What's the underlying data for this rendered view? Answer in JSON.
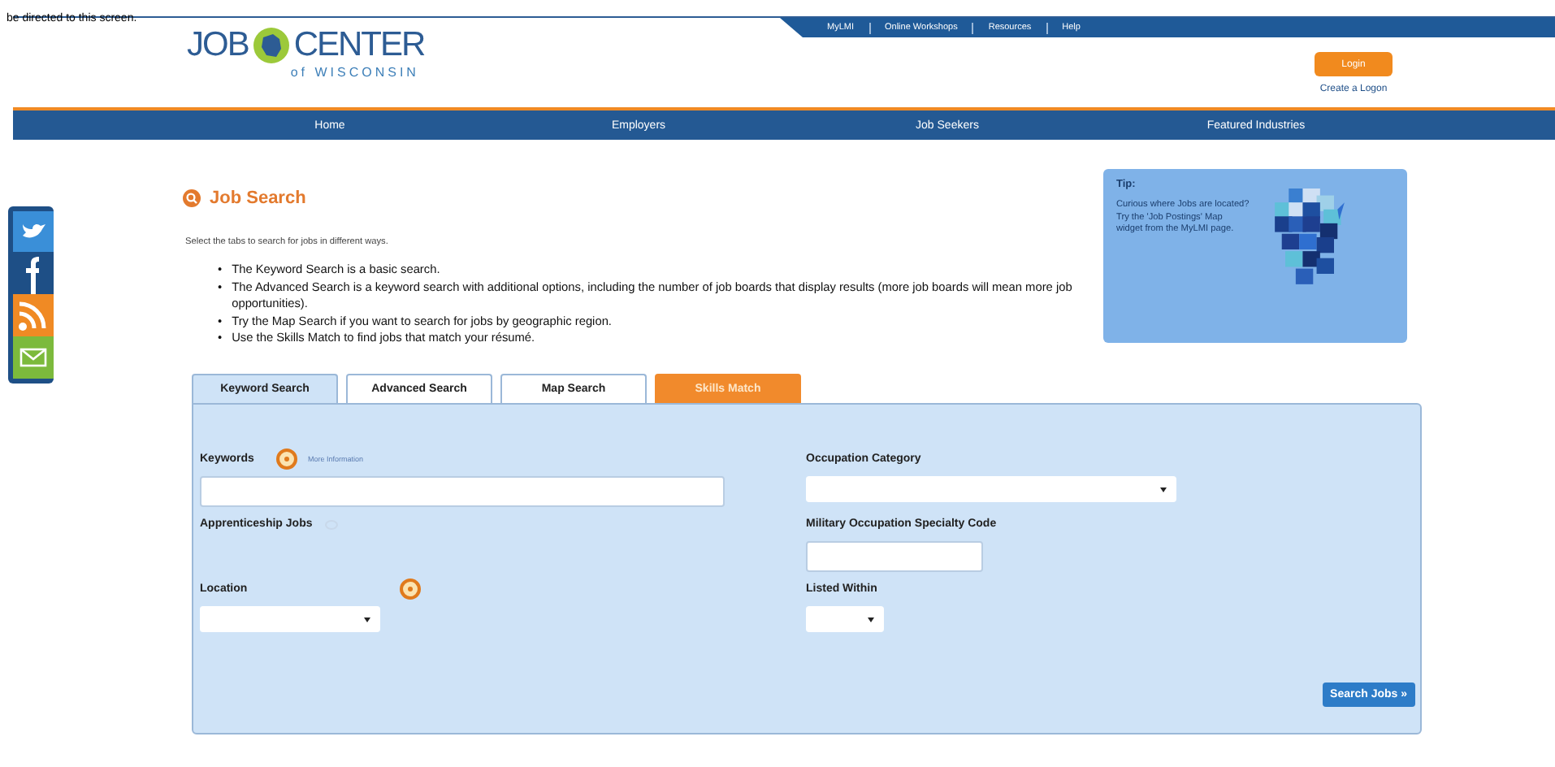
{
  "caption": "be directed to this screen.",
  "utility_links": [
    "MyLMI",
    "Online Workshops",
    "Resources",
    "Help"
  ],
  "logo": {
    "word_1": "JOB",
    "word_2": "CENTER",
    "subtitle": "of WISCONSIN"
  },
  "login": {
    "button": "Login",
    "link": "Create a Logon"
  },
  "nav": [
    "Home",
    "Employers",
    "Job Seekers",
    "Featured Industries"
  ],
  "heading": "Job Search",
  "intro": "Select the tabs to search for jobs in different ways.",
  "bullets": [
    {
      "marker": "•",
      "text": "The Keyword Search is a basic search."
    },
    {
      "marker": "•",
      "text": "The Advanced Search is a keyword search with additional options, including the number of job boards that display results (more job boards will mean more job opportunities)."
    },
    {
      "marker": "•",
      "text": "Try the Map Search if you want to search for jobs by geographic region."
    },
    {
      "marker": "•",
      "text": "Use the Skills Match to find jobs that match your résumé."
    }
  ],
  "tip": {
    "title": "Tip:",
    "text": "Curious where Jobs are located? Try the 'Job Postings' Map widget from the MyLMI page."
  },
  "tabs": [
    {
      "label": "Keyword Search",
      "selected": true,
      "kind": "plain"
    },
    {
      "label": "Advanced Search",
      "selected": false,
      "kind": "plain"
    },
    {
      "label": "Map Search",
      "selected": false,
      "kind": "plain"
    },
    {
      "label": "Skills Match",
      "selected": false,
      "kind": "accent"
    }
  ],
  "left_fields": [
    {
      "kind": "text",
      "label": "Keywords",
      "help": true,
      "link": "More Information"
    },
    {
      "kind": "checkbox",
      "label": "Apprenticeship Jobs",
      "checked": false
    },
    {
      "kind": "select",
      "label": "Location",
      "help": true
    }
  ],
  "right_fields": [
    {
      "kind": "select",
      "label": "Occupation Category"
    },
    {
      "kind": "text",
      "label": "Military Occupation Specialty Code"
    },
    {
      "kind": "select",
      "label": "Listed Within"
    }
  ],
  "search_button": "Search Jobs »"
}
